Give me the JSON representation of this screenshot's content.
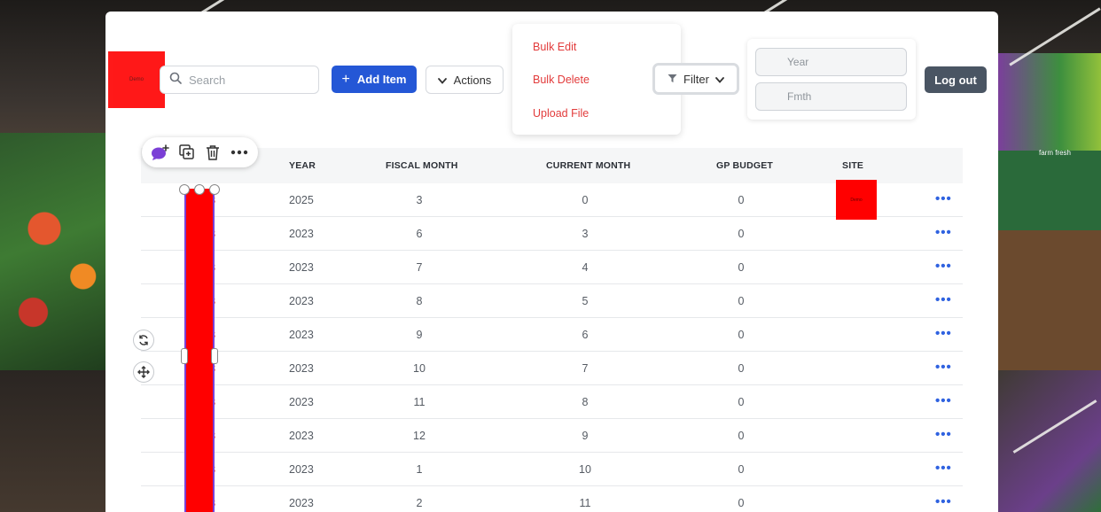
{
  "logo": {
    "text": "Demo"
  },
  "search": {
    "placeholder": "Search",
    "icon": "search-icon"
  },
  "toolbar": {
    "add_label": "Add Item",
    "add_icon": "+",
    "actions_label": "Actions",
    "filter_label": "Filter",
    "logout_label": "Log out"
  },
  "actions_menu": {
    "items": [
      "Bulk Edit",
      "Bulk Delete",
      "Upload File"
    ]
  },
  "filter_fields": {
    "year_placeholder": "Year",
    "fmth_placeholder": "Fmth"
  },
  "table": {
    "headers": {
      "year": "YEAR",
      "fiscal_month": "FISCAL MONTH",
      "current_month": "CURRENT MONTH",
      "gp_budget": "GP BUDGET",
      "site": "SITE"
    },
    "rows": [
      {
        "id": "FG03",
        "year": "2025",
        "fiscal_month": "3",
        "current_month": "0",
        "gp_budget": "0"
      },
      {
        "id": "FG03",
        "year": "2023",
        "fiscal_month": "6",
        "current_month": "3",
        "gp_budget": "0"
      },
      {
        "id": "FG03",
        "year": "2023",
        "fiscal_month": "7",
        "current_month": "4",
        "gp_budget": "0"
      },
      {
        "id": "FG03",
        "year": "2023",
        "fiscal_month": "8",
        "current_month": "5",
        "gp_budget": "0"
      },
      {
        "id": "FG03",
        "year": "2023",
        "fiscal_month": "9",
        "current_month": "6",
        "gp_budget": "0"
      },
      {
        "id": "FG03",
        "year": "2023",
        "fiscal_month": "10",
        "current_month": "7",
        "gp_budget": "0"
      },
      {
        "id": "FG03",
        "year": "2023",
        "fiscal_month": "11",
        "current_month": "8",
        "gp_budget": "0"
      },
      {
        "id": "FG03",
        "year": "2023",
        "fiscal_month": "12",
        "current_month": "9",
        "gp_budget": "0"
      },
      {
        "id": "FG03",
        "year": "2023",
        "fiscal_month": "1",
        "current_month": "10",
        "gp_budget": "0"
      },
      {
        "id": "FG03",
        "year": "2023",
        "fiscal_month": "2",
        "current_month": "11",
        "gp_budget": "0"
      }
    ],
    "site_badge_text": "Demo",
    "more_label": "•••"
  },
  "background": {
    "store_sign": "farm fresh"
  },
  "colors": {
    "primary": "#2457d6",
    "danger_text": "#e23b3b",
    "logout_bg": "#4a5563",
    "selection": "#7b3fd6",
    "highlight": "#ff0000"
  }
}
